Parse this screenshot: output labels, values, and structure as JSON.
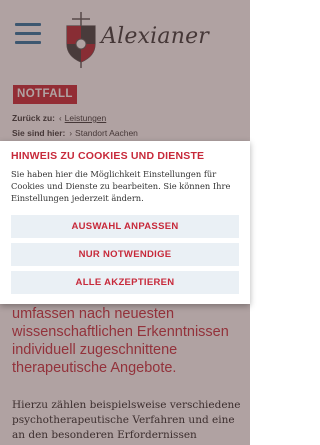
{
  "header": {
    "logo_text": "Alexianer"
  },
  "notfall": {
    "label": "NOTFALL"
  },
  "breadcrumb": {
    "back_label": "Zurück zu:",
    "back_link": "Leistungen",
    "here_label": "Sie sind hier:",
    "here_value": "Standort Aachen"
  },
  "content": {
    "lead": "umfassen nach neuesten wissenschaftlichen Erkenntnissen individuell zugeschnittene therapeutische Angebote.",
    "body": "Hierzu zählen beispielsweise verschiedene psychotherapeutische Verfahren und eine an den besonderen Erfordernissen orientierte"
  },
  "cookie": {
    "title": "HINWEIS ZU COOKIES UND DIENSTE",
    "text": "Sie haben hier die Möglichkeit Einstellungen für Cookies und Dienste zu bearbeiten. Sie können Ihre Einstellungen jederzeit ändern.",
    "btn_customize": "AUSWAHL ANPASSEN",
    "btn_necessary": "NUR NOTWENDIGE",
    "btn_accept_all": "ALLE AKZEPTIEREN"
  },
  "colors": {
    "brand_red": "#c7293a",
    "brand_blue": "#24709f",
    "button_bg": "#eaf0f5"
  }
}
